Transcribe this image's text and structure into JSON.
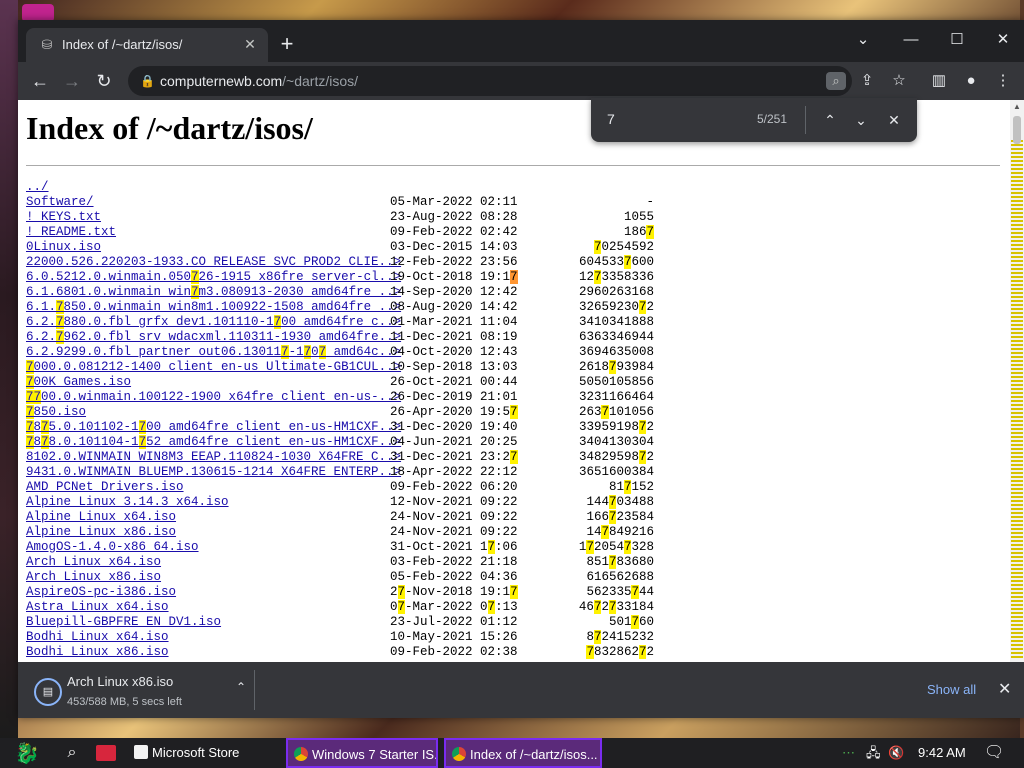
{
  "browser": {
    "tab_title": "Index of /~dartz/isos/",
    "url_host": "computernewb.com",
    "url_path": "/~dartz/isos/",
    "icons": {
      "favicon": "server-icon",
      "tab_close": "close-icon",
      "new_tab": "plus-icon",
      "minimize": "minimize-icon",
      "maximize": "maximize-icon",
      "close": "close-icon",
      "back": "back-arrow-icon",
      "forward": "forward-arrow-icon",
      "reload": "reload-icon",
      "lock": "lock-icon",
      "search_in_page": "search-page-icon",
      "share": "share-icon",
      "bookmark": "star-icon",
      "sidebar": "sidebar-icon",
      "profile": "profile-icon",
      "menu": "kebab-menu-icon"
    }
  },
  "find": {
    "query": "7",
    "count": "5/251",
    "highlight_color": "#fff200",
    "active_color": "#ff9632"
  },
  "page": {
    "title": "Index of /~dartz/isos/",
    "rows": [
      {
        "name": "../",
        "date": "",
        "size": ""
      },
      {
        "name": "Software/",
        "date": "05-Mar-2022 02:11",
        "size": "-"
      },
      {
        "name": "! KEYS.txt",
        "date": "23-Aug-2022 08:28",
        "size": "1055"
      },
      {
        "name": "! README.txt",
        "date": "09-Feb-2022 02:42",
        "size": "1867"
      },
      {
        "name": "0Linux.iso",
        "date": "03-Dec-2015 14:03",
        "size": "70254592"
      },
      {
        "name": "22000.526.220203-1933.CO_RELEASE_SVC_PROD2_CLIE..>",
        "date": "12-Feb-2022 23:56",
        "size": "6045337600"
      },
      {
        "name": "6.0.5212.0.winmain.050726-1915_x86fre_server-cl..>",
        "date": "19-Oct-2018 19:17",
        "size": "1273358336"
      },
      {
        "name": "6.1.6801.0.winmain_win7m3.080913-2030_amd64fre_..>",
        "date": "14-Sep-2020 12:42",
        "size": "2960263168"
      },
      {
        "name": "6.1.7850.0.winmain_win8m1.100922-1508_amd64fre_..>",
        "date": "08-Aug-2020 14:42",
        "size": "3265923072"
      },
      {
        "name": "6.2.7880.0.fbl_grfx_dev1.101110-1700_amd64fre_c..>",
        "date": "01-Mar-2021 11:04",
        "size": "3410341888"
      },
      {
        "name": "6.2.7962.0.fbl_srv_wdacxml.110311-1930_amd64fre..>",
        "date": "11-Dec-2021 08:19",
        "size": "6363346944"
      },
      {
        "name": "6.2.9299.0.fbl_partner_out06.130117-1707_amd64c..>",
        "date": "04-Oct-2020 12:43",
        "size": "3694635008"
      },
      {
        "name": "7000.0.081212-1400_client_en-us_Ultimate-GB1CUL..>",
        "date": "10-Sep-2018 13:03",
        "size": "2618793984"
      },
      {
        "name": "700K Games.iso",
        "date": "26-Oct-2021 00:44",
        "size": "5050105856"
      },
      {
        "name": "7700.0.winmain.100122-1900_x64fre_client_en-us-..>",
        "date": "26-Dec-2019 21:01",
        "size": "3231166464"
      },
      {
        "name": "7850.iso",
        "date": "26-Apr-2020 19:57",
        "size": "2637101056"
      },
      {
        "name": "7875.0.101102-1700_amd64fre_client_en-us-HM1CXF..>",
        "date": "31-Dec-2020 19:40",
        "size": "3395919872"
      },
      {
        "name": "7878.0.101104-1752_amd64fre_client_en-us-HM1CXF..>",
        "date": "04-Jun-2021 20:25",
        "size": "3404130304"
      },
      {
        "name": "8102.0.WINMAIN_WIN8M3_EEAP.110824-1030_X64FRE_C..>",
        "date": "31-Dec-2021 23:27",
        "size": "3482959872"
      },
      {
        "name": "9431.0.WINMAIN_BLUEMP.130615-1214_X64FRE_ENTERP..>",
        "date": "18-Apr-2022 22:12",
        "size": "3651600384"
      },
      {
        "name": "AMD PCNet Drivers.iso",
        "date": "09-Feb-2022 06:20",
        "size": "817152"
      },
      {
        "name": "Alpine Linux 3.14.3 x64.iso",
        "date": "12-Nov-2021 09:22",
        "size": "144703488"
      },
      {
        "name": "Alpine Linux x64.iso",
        "date": "24-Nov-2021 09:22",
        "size": "166723584"
      },
      {
        "name": "Alpine Linux x86.iso",
        "date": "24-Nov-2021 09:22",
        "size": "147849216"
      },
      {
        "name": "AmogOS-1.4.0-x86_64.iso",
        "date": "31-Oct-2021 17:06",
        "size": "1720547328"
      },
      {
        "name": "Arch Linux x64.iso",
        "date": "03-Feb-2022 21:18",
        "size": "851783680"
      },
      {
        "name": "Arch Linux x86.iso",
        "date": "05-Feb-2022 04:36",
        "size": "616562688"
      },
      {
        "name": "AspireOS-pc-i386.iso",
        "date": "27-Nov-2018 19:17",
        "size": "562335744"
      },
      {
        "name": "Astra Linux x64.iso",
        "date": "07-Mar-2022 07:13",
        "size": "4672733184"
      },
      {
        "name": "Bluepill-GBPFRE_EN_DV1.iso",
        "date": "23-Jul-2022 01:12",
        "size": "501760"
      },
      {
        "name": "Bodhi Linux x64.iso",
        "date": "10-May-2021 15:26",
        "size": "872415232"
      },
      {
        "name": "Bodhi Linux x86.iso",
        "date": "09-Feb-2022 02:38",
        "size": "783286272"
      }
    ]
  },
  "download": {
    "file_name": "Arch Linux x86.iso",
    "status": "453/588 MB, 5 secs left",
    "show_all": "Show all",
    "icon": "download-progress-icon"
  },
  "taskbar": {
    "apps": [
      {
        "label": "Microsoft Store",
        "icon": "store-icon"
      },
      {
        "label": "Windows 7 Starter IS...",
        "icon": "chrome-icon"
      },
      {
        "label": "Index of /~dartz/isos...",
        "icon": "chrome-icon"
      }
    ],
    "clock": "9:42 AM"
  }
}
